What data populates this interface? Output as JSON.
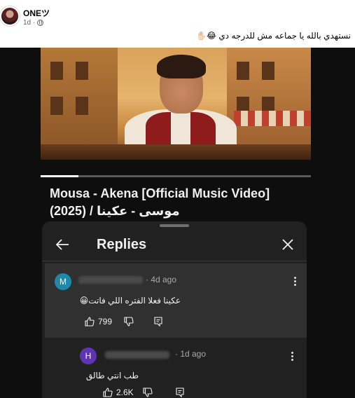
{
  "post": {
    "author": "ONEツ",
    "time": "1d ·",
    "caption": "نستهدي بالله يا جماعه مش للدرجه دي 😂✋🏻"
  },
  "video": {
    "title_line1": "Mousa - Akena [Official Music Video]",
    "title_line2": "موسى - عكينا / (2025)",
    "progress": 0.14
  },
  "replies_panel": {
    "title": "Replies",
    "comments": [
      {
        "avatar_letter": "M",
        "avatar_color": "#1e88a8",
        "time": "· 4d ago",
        "text": "عكينا فعلا الفتره اللي فاتت😀",
        "likes": "799"
      },
      {
        "avatar_letter": "H",
        "avatar_color": "#5e35b1",
        "time": "· 1d ago",
        "text": "طب انتي طالق",
        "likes": "2.6K"
      }
    ]
  },
  "icons": {
    "globe": "globe-icon",
    "back": "back-arrow-icon",
    "close": "close-icon",
    "like": "thumbs-up-icon",
    "dislike": "thumbs-down-icon",
    "reply": "reply-icon",
    "more": "more-vertical-icon"
  }
}
